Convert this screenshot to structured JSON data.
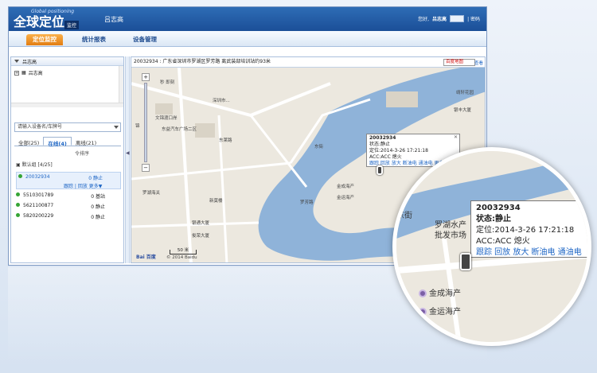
{
  "header": {
    "logo_main": "全球定位",
    "logo_sub": "Global positioning",
    "logo_badge": "监控",
    "user_name": "吕志高",
    "greeting": "您好,",
    "greeting_name": "吕志高",
    "password_link": "| 密码"
  },
  "nav": {
    "tabs": [
      {
        "label": "定位监控",
        "active": true
      },
      {
        "label": "统计报表",
        "active": false
      },
      {
        "label": "设备管理",
        "active": false
      }
    ]
  },
  "sidebar": {
    "panel_title": "吕志高",
    "tree_item": "吕志高",
    "search_placeholder": "请输入设备名/车牌号",
    "filter_tabs": [
      "全部(25)",
      "在线(4)",
      "离线(21)"
    ],
    "sort_label": "令排序",
    "group_label": "默认组",
    "group_count": "[4/25]",
    "devices": [
      {
        "id": "20032934",
        "status": "0 静止"
      },
      {
        "id": "5510301789",
        "status": "0 基站"
      },
      {
        "id": "5621100877",
        "status": "0 静止"
      },
      {
        "id": "5820200229",
        "status": "0 静止"
      }
    ],
    "device_actions": "跟踪 | 回放   更多▼"
  },
  "map": {
    "address_bar": "20032934 : 广东省深圳市罗湖区罗芳路 离武装部培训站约93米",
    "map_type": "百度地图",
    "view_link": "查看",
    "copyright": "© 2014 Baidu",
    "scale": "50 米",
    "logo": "Bai 百度",
    "labels": {
      "l1": "秒 即刻",
      "l2": "深圳市...",
      "l3": "文锦渡口岸",
      "l4": "东益汽车广场二区",
      "l5": "罗湖海关",
      "l6": "新莫楼",
      "l7": "银通大厦",
      "l8": "俊荣大厦",
      "l9": "靖轩花园",
      "l10": "银丰大厦",
      "l11": "金成海产",
      "l12": "金运海产",
      "l13": "罗湖水产批发市场",
      "l14": "东街",
      "l15": "罗芳路",
      "l16": "东莱路",
      "l17": "锦"
    }
  },
  "popup": {
    "id": "20032934",
    "status": "状态:静止",
    "located": "定位:2014-3-26 17:21:18",
    "acc": "ACC:ACC 熄火",
    "links": "跟踪 回放 放大 断油电 通油电 更多▼"
  },
  "magnifier": {
    "id": "20032934",
    "status": "状态:静止",
    "located": "定位:2014-3-26 17:21:18",
    "acc": "ACC:ACC 熄火",
    "links": "跟踪 回放 放大 断油电 通油电",
    "labels": {
      "m1": "东街",
      "m2": "罗湖水产",
      "m3": "批发市场",
      "m4": "金成海产",
      "m5": "金运海产"
    }
  },
  "colors": {
    "header": "#1b4f98",
    "active_tab": "#e27d12",
    "river": "#8fb3d9",
    "map_bg": "#ece8df",
    "link": "#1e66c5"
  }
}
